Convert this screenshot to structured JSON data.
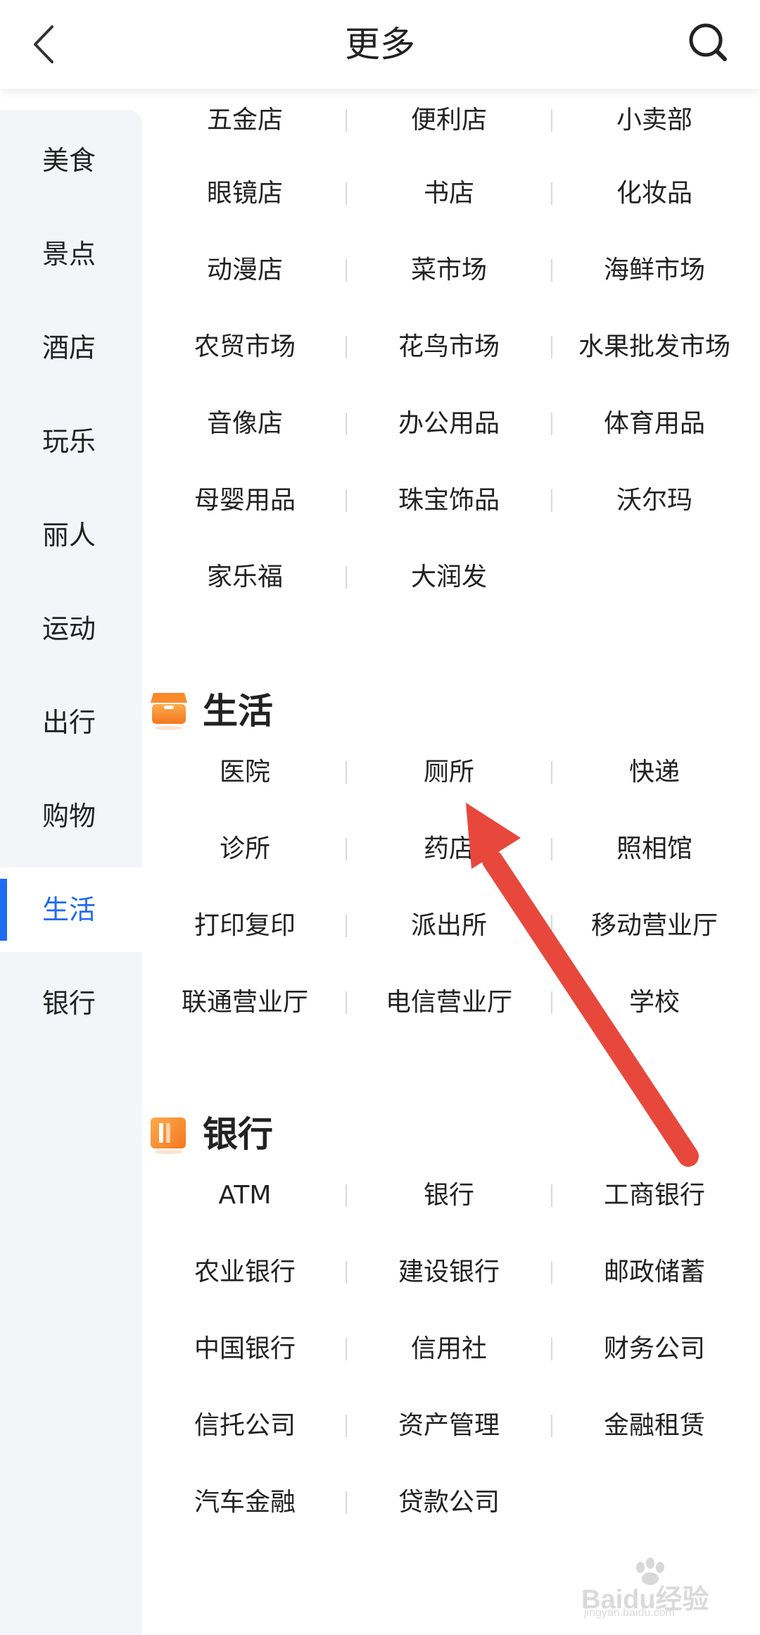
{
  "header": {
    "title": "更多"
  },
  "sidebar": {
    "items": [
      {
        "label": "美食"
      },
      {
        "label": "景点"
      },
      {
        "label": "酒店"
      },
      {
        "label": "玩乐"
      },
      {
        "label": "丽人"
      },
      {
        "label": "运动"
      },
      {
        "label": "出行"
      },
      {
        "label": "购物"
      },
      {
        "label": "生活"
      },
      {
        "label": "银行"
      }
    ],
    "active_index": 8
  },
  "shopping": {
    "rows": [
      [
        "五金店",
        "便利店",
        "小卖部"
      ],
      [
        "眼镜店",
        "书店",
        "化妆品"
      ],
      [
        "动漫店",
        "菜市场",
        "海鲜市场"
      ],
      [
        "农贸市场",
        "花鸟市场",
        "水果批发市场"
      ],
      [
        "音像店",
        "办公用品",
        "体育用品"
      ],
      [
        "母婴用品",
        "珠宝饰品",
        "沃尔玛"
      ],
      [
        "家乐福",
        "大润发"
      ]
    ]
  },
  "life": {
    "title": "生活",
    "icon": "shop-icon",
    "rows": [
      [
        "医院",
        "厕所",
        "快递"
      ],
      [
        "诊所",
        "药店",
        "照相馆"
      ],
      [
        "打印复印",
        "派出所",
        "移动营业厅"
      ],
      [
        "联通营业厅",
        "电信营业厅",
        "学校"
      ]
    ]
  },
  "bank": {
    "title": "银行",
    "icon": "bank-card-icon",
    "rows": [
      [
        "ATM",
        "银行",
        "工商银行"
      ],
      [
        "农业银行",
        "建设银行",
        "邮政储蓄"
      ],
      [
        "中国银行",
        "信用社",
        "财务公司"
      ],
      [
        "信托公司",
        "资产管理",
        "金融租赁"
      ],
      [
        "汽车金融",
        "贷款公司"
      ]
    ]
  },
  "watermark": {
    "text": "Baidu经验",
    "sub": "jingyan.baidu.com"
  },
  "colors": {
    "accent": "#1e6cf0",
    "section_icon": "#f98a2c",
    "annotation_arrow": "#e8473c"
  }
}
